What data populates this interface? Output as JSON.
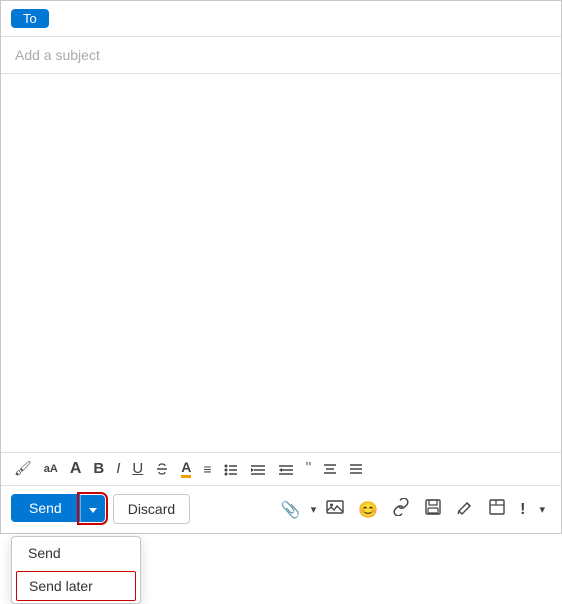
{
  "compose": {
    "to_label": "To",
    "subject_placeholder": "Add a subject",
    "body_text": "",
    "toolbar": {
      "format_painter": "🖌",
      "font_size_decrease": "aA",
      "font_size_increase": "A",
      "bold": "B",
      "italic": "I",
      "underline": "U",
      "strikethrough": "✗",
      "font_color": "A",
      "align_left": "≡",
      "bullets": "≡",
      "indent_decrease": "←≡",
      "indent_increase": "≡→",
      "quote": "\"",
      "align_center": "≡",
      "more_options": "≡"
    },
    "send_label": "Send",
    "dropdown_chevron": "▾",
    "discard_label": "Discard",
    "dropdown_menu": {
      "send_item": "Send",
      "send_later_item": "Send later"
    },
    "icons": {
      "attachment": "📎",
      "attachment_dropdown": "▾",
      "image": "🖼",
      "emoji": "😊",
      "link": "🔗",
      "save": "💾",
      "edit": "✏",
      "template": "📋",
      "importance": "!",
      "more": "▾"
    }
  }
}
